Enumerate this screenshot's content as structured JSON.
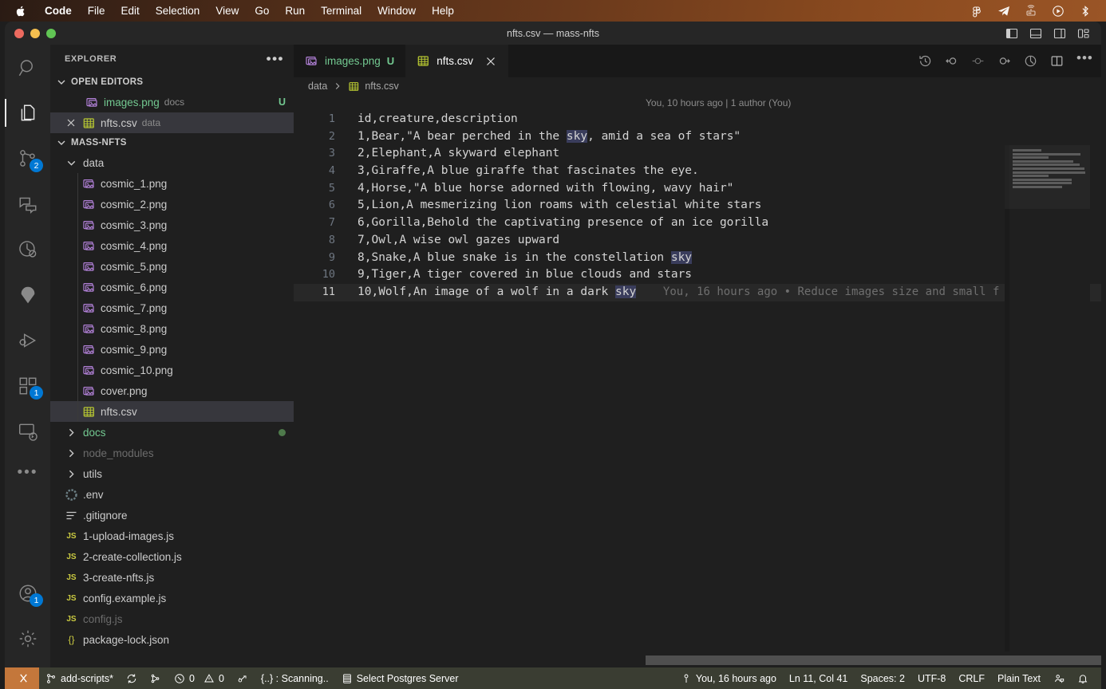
{
  "macmenu": {
    "apple_icon": "apple-logo-icon",
    "items": [
      {
        "label": "Code",
        "bold": true
      },
      {
        "label": "File",
        "bold": false
      },
      {
        "label": "Edit",
        "bold": false
      },
      {
        "label": "Selection",
        "bold": false
      },
      {
        "label": "View",
        "bold": false
      },
      {
        "label": "Go",
        "bold": false
      },
      {
        "label": "Run",
        "bold": false
      },
      {
        "label": "Terminal",
        "bold": false
      },
      {
        "label": "Window",
        "bold": false
      },
      {
        "label": "Help",
        "bold": false
      }
    ],
    "tray_icons": [
      "figma-icon",
      "telegram-icon",
      "router-icon",
      "record-player-icon",
      "bluetooth-icon"
    ]
  },
  "window": {
    "title": "nfts.csv — mass-nfts",
    "layout_buttons": [
      "toggle-primary-sidebar-icon",
      "toggle-panel-icon",
      "toggle-secondary-sidebar-icon",
      "customize-layout-icon"
    ]
  },
  "activitybar": {
    "items": [
      {
        "name": "search",
        "icon": "search-icon",
        "badge": null,
        "active": false
      },
      {
        "name": "explorer",
        "icon": "files-icon",
        "badge": null,
        "active": true
      },
      {
        "name": "source-control",
        "icon": "source-control-icon",
        "badge": "2",
        "active": false
      },
      {
        "name": "chat",
        "icon": "chat-icon",
        "badge": null,
        "active": false
      },
      {
        "name": "testing",
        "icon": "beaker-circle-icon",
        "badge": null,
        "active": false
      },
      {
        "name": "avalanche",
        "icon": "avalanche-icon",
        "badge": null,
        "active": false
      },
      {
        "name": "run-and-debug",
        "icon": "debug-icon",
        "badge": null,
        "active": false
      },
      {
        "name": "extensions",
        "icon": "extensions-icon",
        "badge": "1",
        "active": false
      },
      {
        "name": "remote-explorer",
        "icon": "remote-explorer-icon",
        "badge": null,
        "active": false
      }
    ],
    "overflow_icon": "more-icon",
    "bottom": [
      {
        "name": "accounts",
        "icon": "account-icon",
        "badge": "1"
      },
      {
        "name": "manage-settings",
        "icon": "gear-icon",
        "badge": null
      }
    ]
  },
  "sidebar": {
    "title": "EXPLORER",
    "more_actions": "more-icon",
    "open_editors": {
      "label": "OPEN EDITORS",
      "items": [
        {
          "name": "images.png",
          "description": "docs",
          "icon": "image-file-icon",
          "badge": "U",
          "state": "green",
          "selected": false
        },
        {
          "name": "nfts.csv",
          "description": "data",
          "icon": "csv-file-icon",
          "badge": "",
          "state": "normal",
          "selected": true
        }
      ]
    },
    "workspace": {
      "label": "MASS-NFTS",
      "items": [
        {
          "name": "data",
          "type": "folder",
          "expanded": true,
          "depth": 1,
          "state": "normal"
        },
        {
          "name": "cosmic_1.png",
          "type": "image",
          "depth": 2,
          "state": "normal"
        },
        {
          "name": "cosmic_2.png",
          "type": "image",
          "depth": 2,
          "state": "normal"
        },
        {
          "name": "cosmic_3.png",
          "type": "image",
          "depth": 2,
          "state": "normal"
        },
        {
          "name": "cosmic_4.png",
          "type": "image",
          "depth": 2,
          "state": "normal"
        },
        {
          "name": "cosmic_5.png",
          "type": "image",
          "depth": 2,
          "state": "normal"
        },
        {
          "name": "cosmic_6.png",
          "type": "image",
          "depth": 2,
          "state": "normal"
        },
        {
          "name": "cosmic_7.png",
          "type": "image",
          "depth": 2,
          "state": "normal"
        },
        {
          "name": "cosmic_8.png",
          "type": "image",
          "depth": 2,
          "state": "normal"
        },
        {
          "name": "cosmic_9.png",
          "type": "image",
          "depth": 2,
          "state": "normal"
        },
        {
          "name": "cosmic_10.png",
          "type": "image",
          "depth": 2,
          "state": "normal"
        },
        {
          "name": "cover.png",
          "type": "image",
          "depth": 2,
          "state": "normal"
        },
        {
          "name": "nfts.csv",
          "type": "csv",
          "depth": 2,
          "state": "selected"
        },
        {
          "name": "docs",
          "type": "folder",
          "expanded": false,
          "depth": 1,
          "state": "green-dot"
        },
        {
          "name": "node_modules",
          "type": "folder",
          "expanded": false,
          "depth": 1,
          "state": "dim"
        },
        {
          "name": "utils",
          "type": "folder",
          "expanded": false,
          "depth": 1,
          "state": "normal"
        },
        {
          "name": ".env",
          "type": "gear",
          "depth": 1,
          "state": "normal"
        },
        {
          "name": ".gitignore",
          "type": "lines",
          "depth": 1,
          "state": "normal"
        },
        {
          "name": "1-upload-images.js",
          "type": "js",
          "depth": 1,
          "state": "normal"
        },
        {
          "name": "2-create-collection.js",
          "type": "js",
          "depth": 1,
          "state": "normal"
        },
        {
          "name": "3-create-nfts.js",
          "type": "js",
          "depth": 1,
          "state": "normal"
        },
        {
          "name": "config.example.js",
          "type": "js",
          "depth": 1,
          "state": "normal"
        },
        {
          "name": "config.js",
          "type": "js",
          "depth": 1,
          "state": "dim"
        },
        {
          "name": "package-lock.json",
          "type": "json",
          "depth": 1,
          "state": "normal"
        }
      ]
    }
  },
  "tabs": [
    {
      "label": "images.png",
      "icon": "image-file-icon",
      "badge": "U",
      "active": false,
      "closable": false
    },
    {
      "label": "nfts.csv",
      "icon": "csv-file-icon",
      "badge": "",
      "active": true,
      "closable": true
    }
  ],
  "editor_actions": [
    "timeline-history-icon",
    "previous-change-icon",
    "change-marker-icon",
    "next-change-icon",
    "toggle-blame-icon",
    "split-editor-icon",
    "more-actions-icon"
  ],
  "breadcrumb": {
    "folder": "data",
    "file": "nfts.csv",
    "file_icon": "csv-file-icon"
  },
  "editor": {
    "blame_header": "You, 10 hours ago | 1 author (You)",
    "inline_blame": "You, 16 hours ago • Reduce images size and small f",
    "active_line": 11,
    "search_highlight": "sky",
    "lines": [
      {
        "n": 1,
        "text": "id,creature,description"
      },
      {
        "n": 2,
        "text": "1,Bear,\"A bear perched in the sky, amid a sea of stars\""
      },
      {
        "n": 3,
        "text": "2,Elephant,A skyward elephant"
      },
      {
        "n": 4,
        "text": "3,Giraffe,A blue giraffe that fascinates the eye."
      },
      {
        "n": 5,
        "text": "4,Horse,\"A blue horse adorned with flowing, wavy hair\""
      },
      {
        "n": 6,
        "text": "5,Lion,A mesmerizing lion roams with celestial white stars"
      },
      {
        "n": 7,
        "text": "6,Gorilla,Behold the captivating presence of an ice gorilla"
      },
      {
        "n": 8,
        "text": "7,Owl,A wise owl gazes upward"
      },
      {
        "n": 9,
        "text": "8,Snake,A blue snake is in the constellation sky"
      },
      {
        "n": 10,
        "text": "9,Tiger,A tiger covered in blue clouds and stars"
      },
      {
        "n": 11,
        "text": "10,Wolf,An image of a wolf in a dark sky"
      }
    ]
  },
  "statusbar": {
    "remote_icon": "remote-indicator-icon",
    "left": [
      {
        "name": "git-branch",
        "icon": "branch-icon",
        "label": "add-scripts*"
      },
      {
        "name": "sync-changes",
        "icon": "sync-icon",
        "label": ""
      },
      {
        "name": "git-graph",
        "icon": "git-graph-icon",
        "label": ""
      },
      {
        "name": "problems-errors",
        "icon": "error-icon",
        "label": "0"
      },
      {
        "name": "problems-warnings",
        "icon": "warning-icon",
        "label": "0"
      },
      {
        "name": "ports",
        "icon": "ports-icon",
        "label": ""
      },
      {
        "name": "prettier",
        "icon": "",
        "label": "{..} : Scanning.."
      },
      {
        "name": "postgres-server",
        "icon": "database-icon",
        "label": "Select Postgres Server"
      }
    ],
    "right": [
      {
        "name": "git-blame",
        "icon": "blame-icon",
        "label": "You, 16 hours ago"
      },
      {
        "name": "cursor-position",
        "icon": "",
        "label": "Ln 11, Col 41"
      },
      {
        "name": "indentation",
        "icon": "",
        "label": "Spaces: 2"
      },
      {
        "name": "encoding",
        "icon": "",
        "label": "UTF-8"
      },
      {
        "name": "eol",
        "icon": "",
        "label": "CRLF"
      },
      {
        "name": "language-mode",
        "icon": "",
        "label": "Plain Text"
      },
      {
        "name": "feedback",
        "icon": "feedback-icon",
        "label": ""
      },
      {
        "name": "notifications",
        "icon": "bell-icon",
        "label": ""
      }
    ]
  },
  "colors": {
    "accent_blue": "#0078d4",
    "green": "#73c991",
    "remote_orange": "#c4773b",
    "statusbar_bg": "#3a3d32",
    "editor_bg": "#1f1f1f",
    "sidebar_bg": "#1f1f1f",
    "highlight": "#3a3d5c"
  }
}
